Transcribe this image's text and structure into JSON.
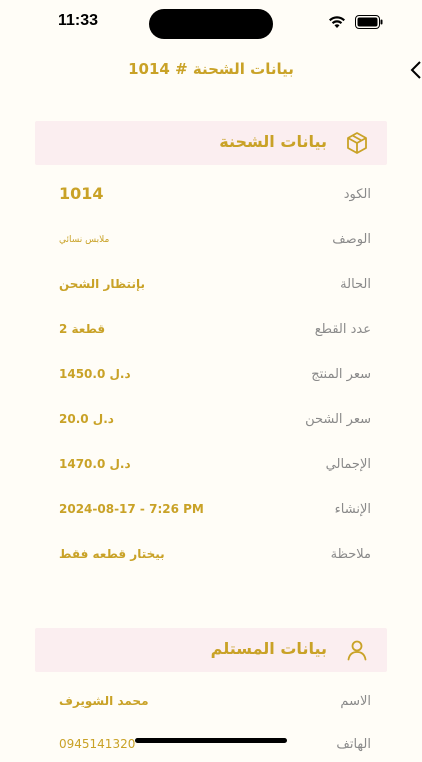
{
  "status": {
    "time": "11:33"
  },
  "nav": {
    "title": "بيانات الشحنة # 1014"
  },
  "shipment_section": {
    "title": "بيانات الشحنة",
    "icon": "box-icon",
    "rows": [
      {
        "label": "الكود",
        "value": "1014"
      },
      {
        "label": "الوصف",
        "value": "ملابس نسائي"
      },
      {
        "label": "الحالة",
        "value": "بإنتظار الشحن"
      },
      {
        "label": "عدد القطع",
        "value": "2 قطعة"
      },
      {
        "label": "سعر المنتج",
        "value": "1450.0 د.ل"
      },
      {
        "label": "سعر الشحن",
        "value": "20.0 د.ل"
      },
      {
        "label": "الإجمالي",
        "value": "1470.0 د.ل"
      },
      {
        "label": "الإنشاء",
        "value": "2024-08-17 - 7:26 PM"
      },
      {
        "label": "ملاحظة",
        "value": "بيختار قطعه فقط"
      }
    ]
  },
  "recipient_section": {
    "title": "بيانات المستلم",
    "icon": "user-icon",
    "rows": [
      {
        "label": "الاسم",
        "value": "محمد الشويرف"
      },
      {
        "label": "الهاتف",
        "value": "0945141320"
      }
    ]
  },
  "colors": {
    "accent": "#c9a227",
    "header_bg": "#fbeef0",
    "label": "#8a8a8a",
    "background": "#fffdf7"
  }
}
